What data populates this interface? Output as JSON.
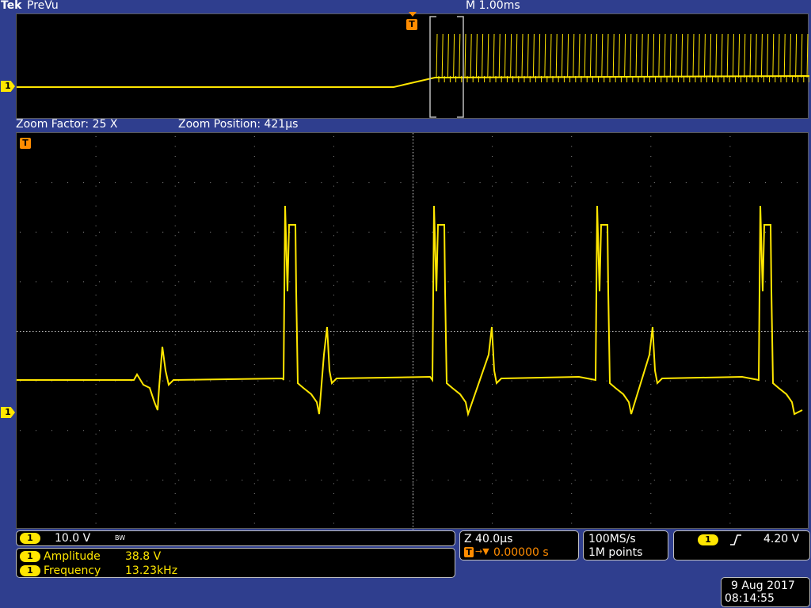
{
  "top_bar": {
    "brand": "Tek",
    "mode": "PreVu",
    "horizontal_scale": "M 1.00ms"
  },
  "zoom": {
    "factor_label": "Zoom Factor: 25 X",
    "position_label": "Zoom Position: 421µs"
  },
  "channel": {
    "number": "1",
    "scale": "10.0 V",
    "bw_limit": "BW",
    "color": "#ffe600"
  },
  "trigger": {
    "marker": "T",
    "color": "#ff8c00"
  },
  "measurements": [
    {
      "channel": "1",
      "name": "Amplitude",
      "value": "38.8 V"
    },
    {
      "channel": "1",
      "name": "Frequency",
      "value": "13.23kHz"
    }
  ],
  "timebase": {
    "zoom_scale": "Z 40.0µs",
    "trigger_position": "0.00000 s"
  },
  "acquisition": {
    "sample_rate": "100MS/s",
    "record_length": "1M points"
  },
  "trigger_settings": {
    "source": "1",
    "slope": "rising",
    "level": "4.20 V"
  },
  "datetime": {
    "date": "9 Aug 2017",
    "time": "08:14:55"
  }
}
